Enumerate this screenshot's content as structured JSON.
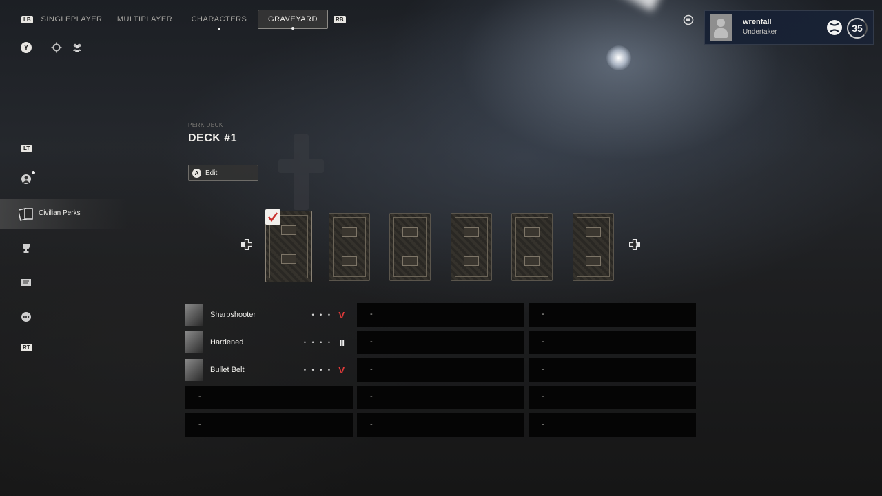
{
  "nav": {
    "lb": "LB",
    "rb": "RB",
    "tabs": [
      {
        "label": "SINGLEPLAYER"
      },
      {
        "label": "MULTIPLAYER"
      },
      {
        "label": "CHARACTERS"
      },
      {
        "label": "GRAVEYARD"
      }
    ],
    "y_button": "Y"
  },
  "profile": {
    "name": "wrenfall",
    "title": "Undertaker",
    "level": "35"
  },
  "rail": {
    "lt": "LT",
    "rt": "RT",
    "active_label": "Civilian Perks"
  },
  "deck": {
    "subtitle": "PERK DECK",
    "title": "DECK #1",
    "edit_button_key": "A",
    "edit_label": "Edit"
  },
  "perks": [
    {
      "name": "Sharpshooter",
      "dots": "• • •",
      "mark": "V",
      "mark_color": "#e03a3a"
    },
    {
      "name": "Hardened",
      "dots": "• • • •",
      "mark": "II",
      "mark_color": "#f0f0f0"
    },
    {
      "name": "Bullet Belt",
      "dots": "• • • •",
      "mark": "V",
      "mark_color": "#e03a3a"
    }
  ],
  "empty_slot": "-"
}
